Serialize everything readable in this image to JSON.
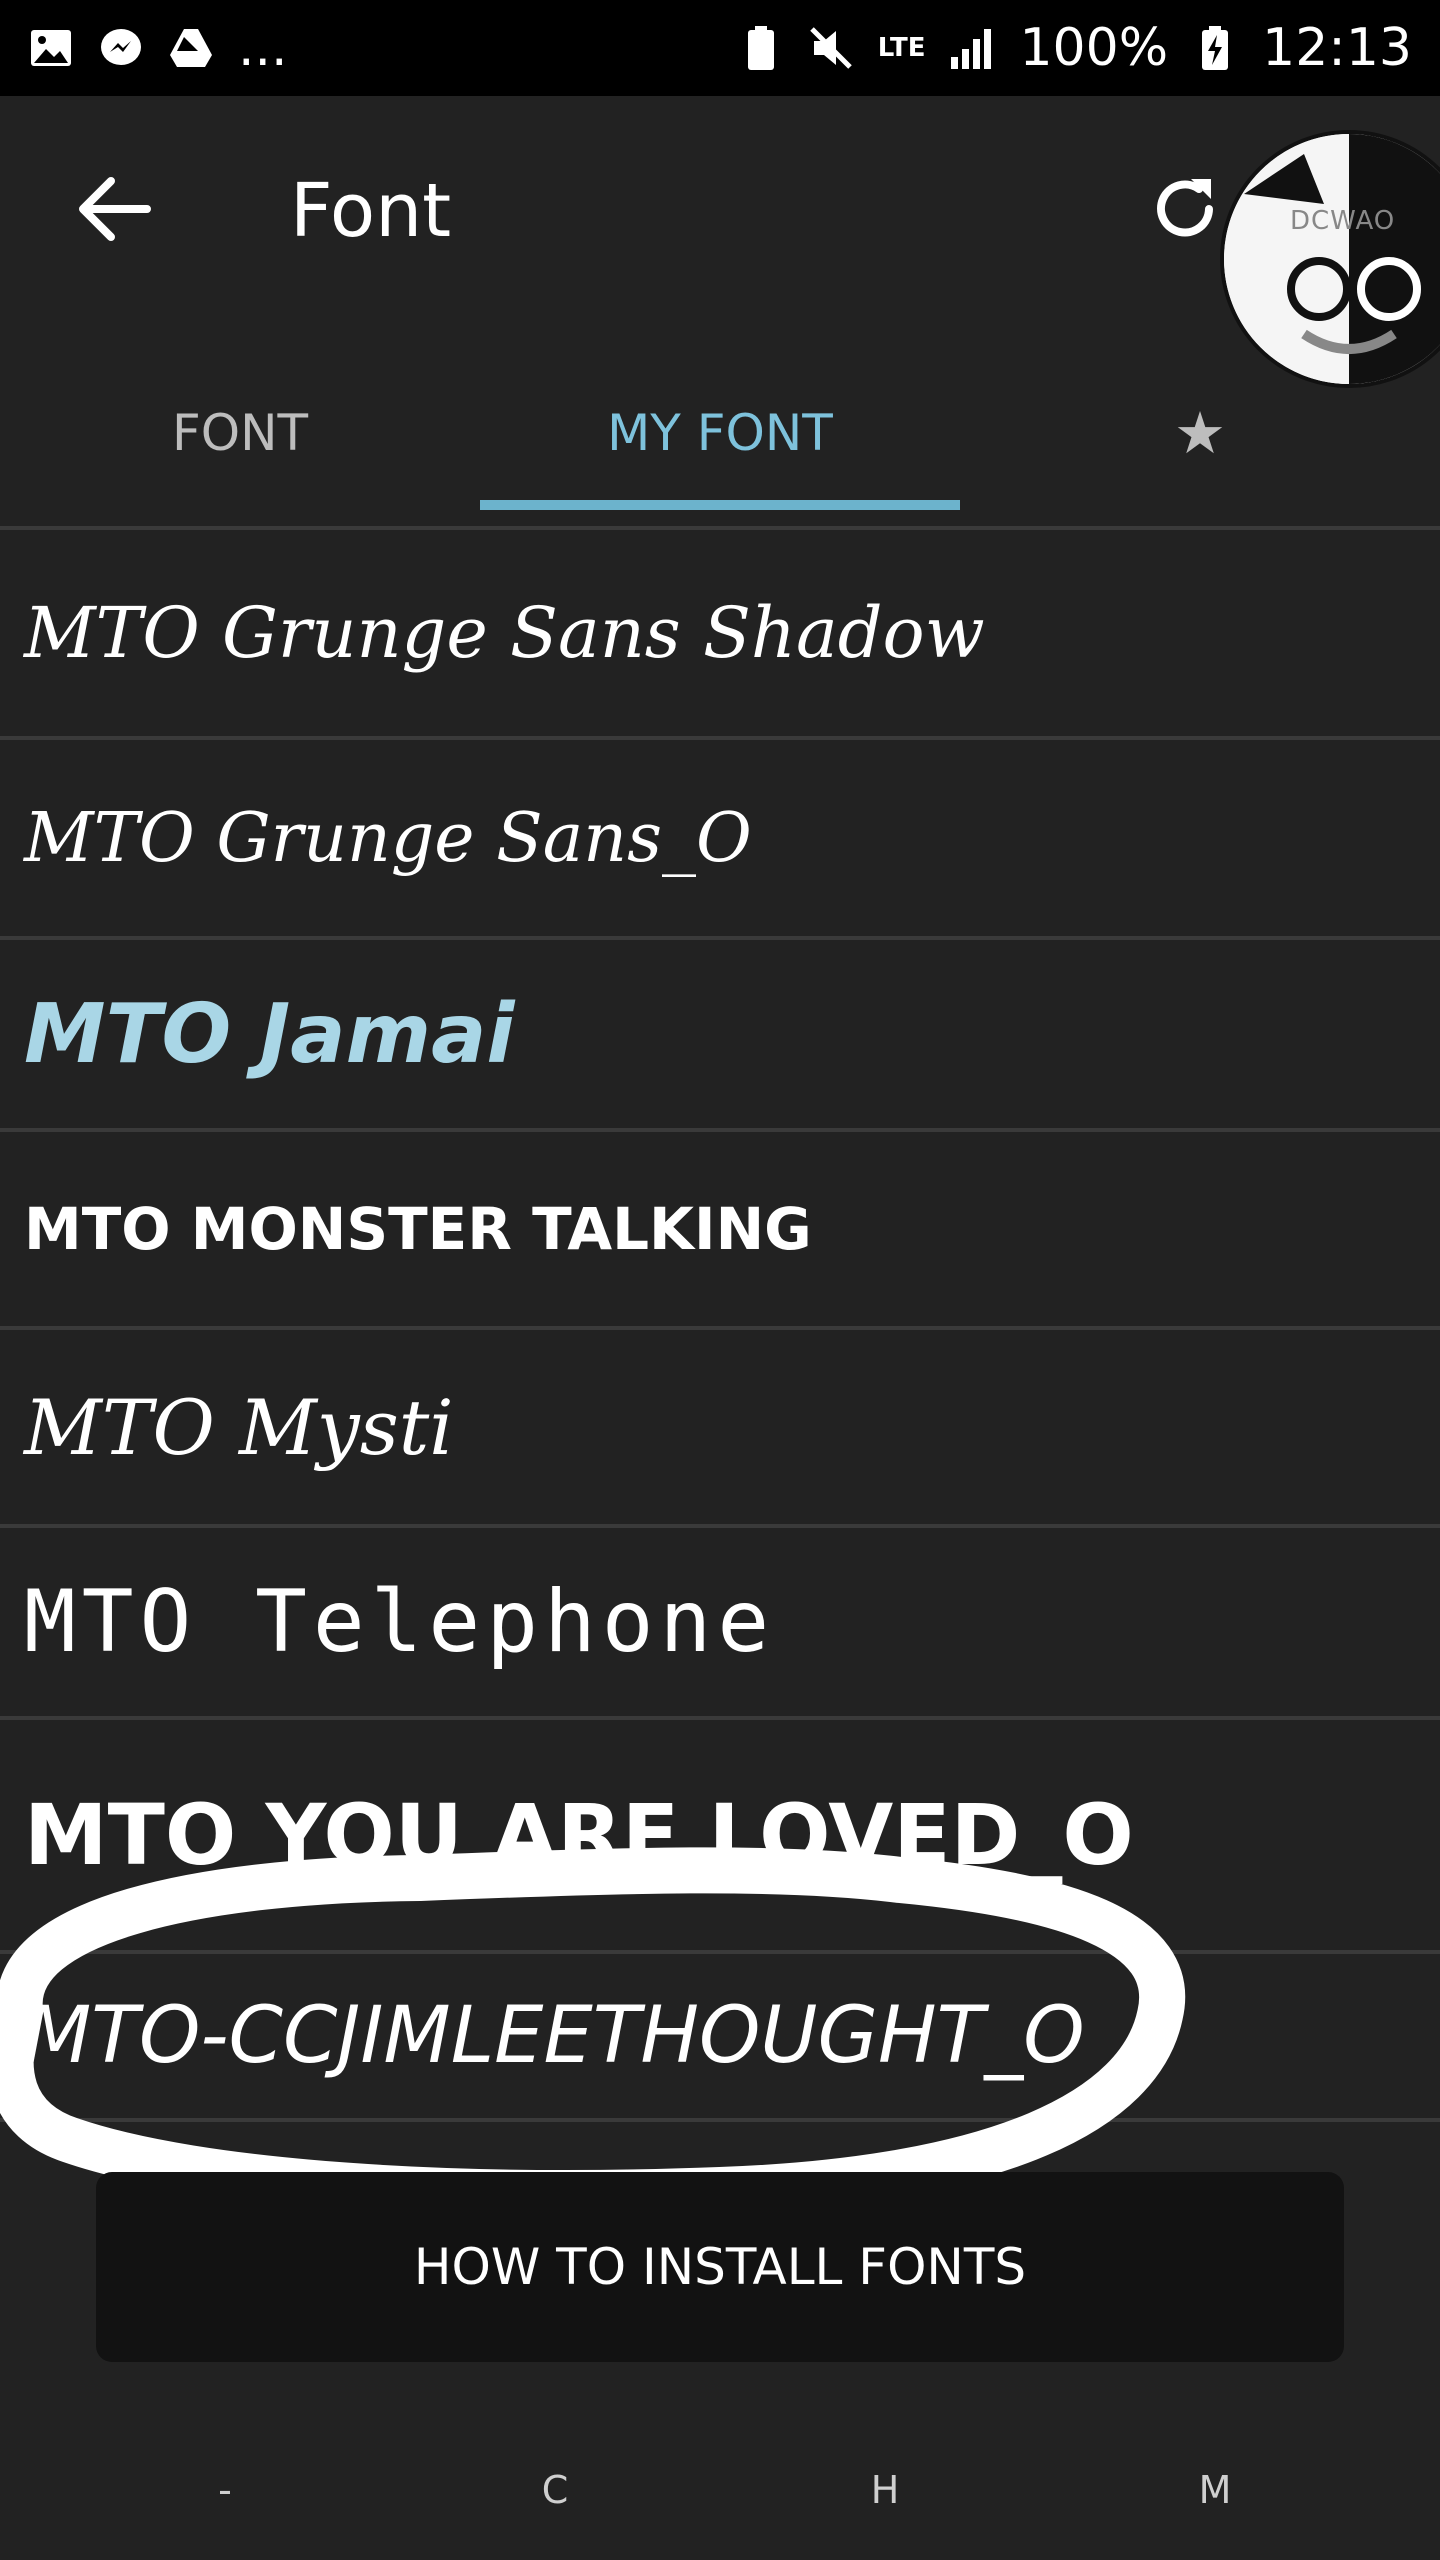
{
  "status_bar": {
    "battery_percent": "100%",
    "time": "12:13",
    "network": "LTE",
    "overflow": "..."
  },
  "app_bar": {
    "title": "Font",
    "avatar_text": "DCWAO"
  },
  "tabs": [
    {
      "label": "FONT",
      "active": false
    },
    {
      "label": "MY FONT",
      "active": true
    },
    {
      "label": "★",
      "active": false
    }
  ],
  "fonts": [
    {
      "name": "MTO Grunge Sans Shadow"
    },
    {
      "name": "MTO Grunge Sans_O"
    },
    {
      "name": "MTO Jamai"
    },
    {
      "name": "MTO MONSTER TALKING"
    },
    {
      "name": "MTO Mysti"
    },
    {
      "name": "MTO Telephone"
    },
    {
      "name": "MTO YOU ARE LOVED_O"
    },
    {
      "name": "MTO-CCJIMLEETHOUGHT_O"
    }
  ],
  "install_button": "HOW TO INSTALL FONTS",
  "bottom_nav": [
    "-",
    "C",
    "H",
    "M"
  ],
  "colors": {
    "background": "#222222",
    "accent": "#6cb3cc",
    "highlight_font": "#a9d6e6"
  }
}
